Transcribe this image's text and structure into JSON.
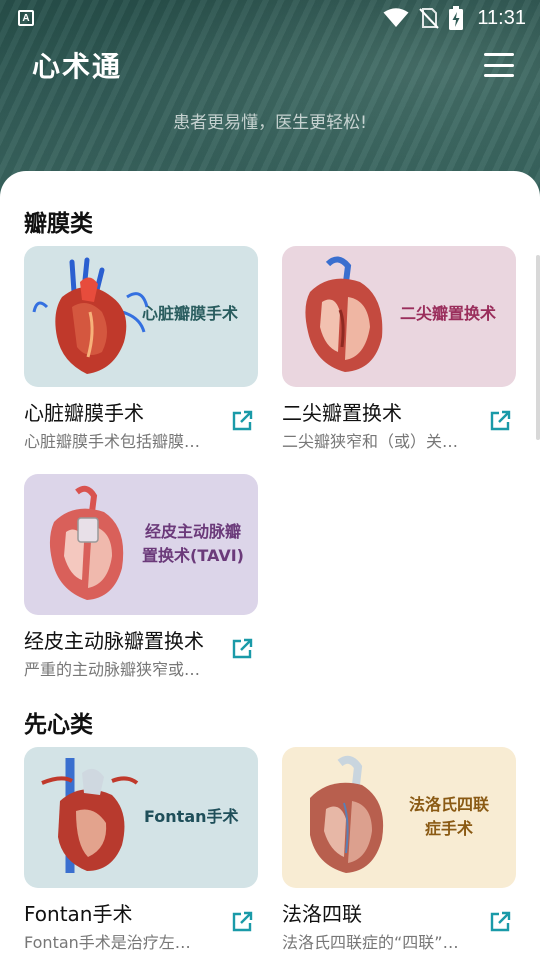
{
  "status_bar": {
    "app_icon_letter": "A",
    "time": "11:31",
    "icons": [
      "wifi-icon",
      "no-sim-icon",
      "battery-charging-icon"
    ]
  },
  "header": {
    "title": "心术通",
    "slogan": "患者更易懂，医生更轻松!",
    "menu_icon": "hamburger-menu-icon"
  },
  "colors": {
    "header_bg": "#2f5a55",
    "link_icon": "#1a9aa8",
    "card_blue": "#d3e3e6",
    "card_pink": "#ead6df",
    "card_purple": "#dcd5e9",
    "card_cream": "#f8ecd3"
  },
  "sections": [
    {
      "title": "瓣膜类",
      "cards": [
        {
          "image_label": "心脏瓣膜手术",
          "title": "心脏瓣膜手术",
          "desc": "心脏瓣膜手术包括瓣膜…",
          "link_icon": "external-link-icon"
        },
        {
          "image_label": "二尖瓣置换术",
          "title": "二尖瓣置换术",
          "desc": "二尖瓣狭窄和（或）关…",
          "link_icon": "external-link-icon"
        },
        {
          "image_label_line1": "经皮主动脉瓣",
          "image_label_line2": "置换术(TAVI)",
          "title": "经皮主动脉瓣置换术",
          "desc": "严重的主动脉瓣狭窄或…",
          "link_icon": "external-link-icon"
        }
      ]
    },
    {
      "title": "先心类",
      "cards": [
        {
          "image_label": "Fontan手术",
          "title": "Fontan手术",
          "desc": "Fontan手术是治疗左…",
          "link_icon": "external-link-icon"
        },
        {
          "image_label_line1": "法洛氏四联",
          "image_label_line2": "症手术",
          "title": "法洛四联",
          "desc": "法洛氏四联症的“四联”…",
          "link_icon": "external-link-icon"
        }
      ]
    }
  ]
}
